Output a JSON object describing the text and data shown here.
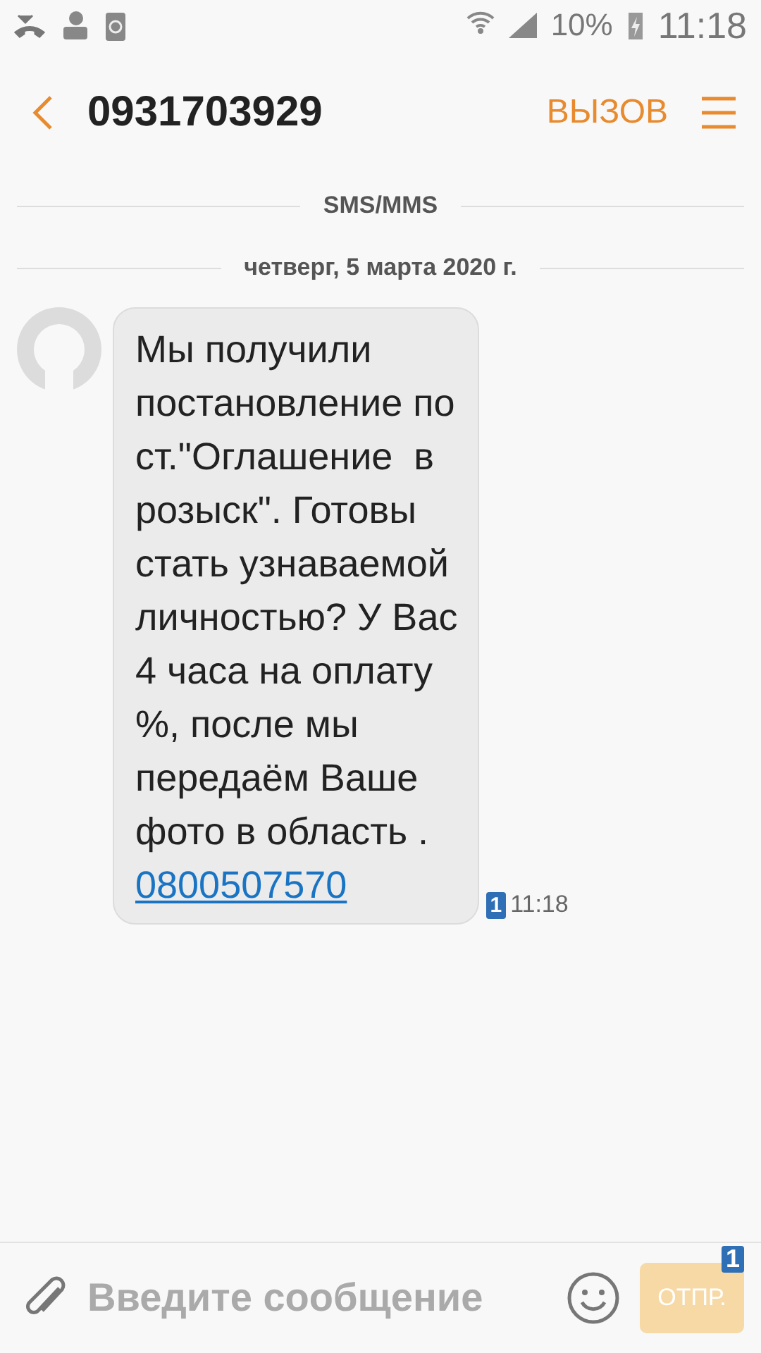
{
  "status_bar": {
    "battery_percent": "10%",
    "time": "11:18"
  },
  "header": {
    "title": "0931703929",
    "call_label": "ВЫЗОВ"
  },
  "dividers": [
    "SMS/MMS",
    "четверг, 5 марта 2020 г."
  ],
  "messages": [
    {
      "text": "Мы получили\nпостановление по\nст.\"Оглашение  в\nрозыск\". Готовы\nстать узнаваемой\nличностью? У Вас\n4 часа на оплату\n%, после мы\nпередаём Ваше\nфото в область .",
      "link": "0800507570",
      "sim": "1",
      "time": "11:18"
    }
  ],
  "composer": {
    "placeholder": "Введите сообщение",
    "send_label": "ОТПР.",
    "send_disabled": true,
    "sim": "1"
  }
}
